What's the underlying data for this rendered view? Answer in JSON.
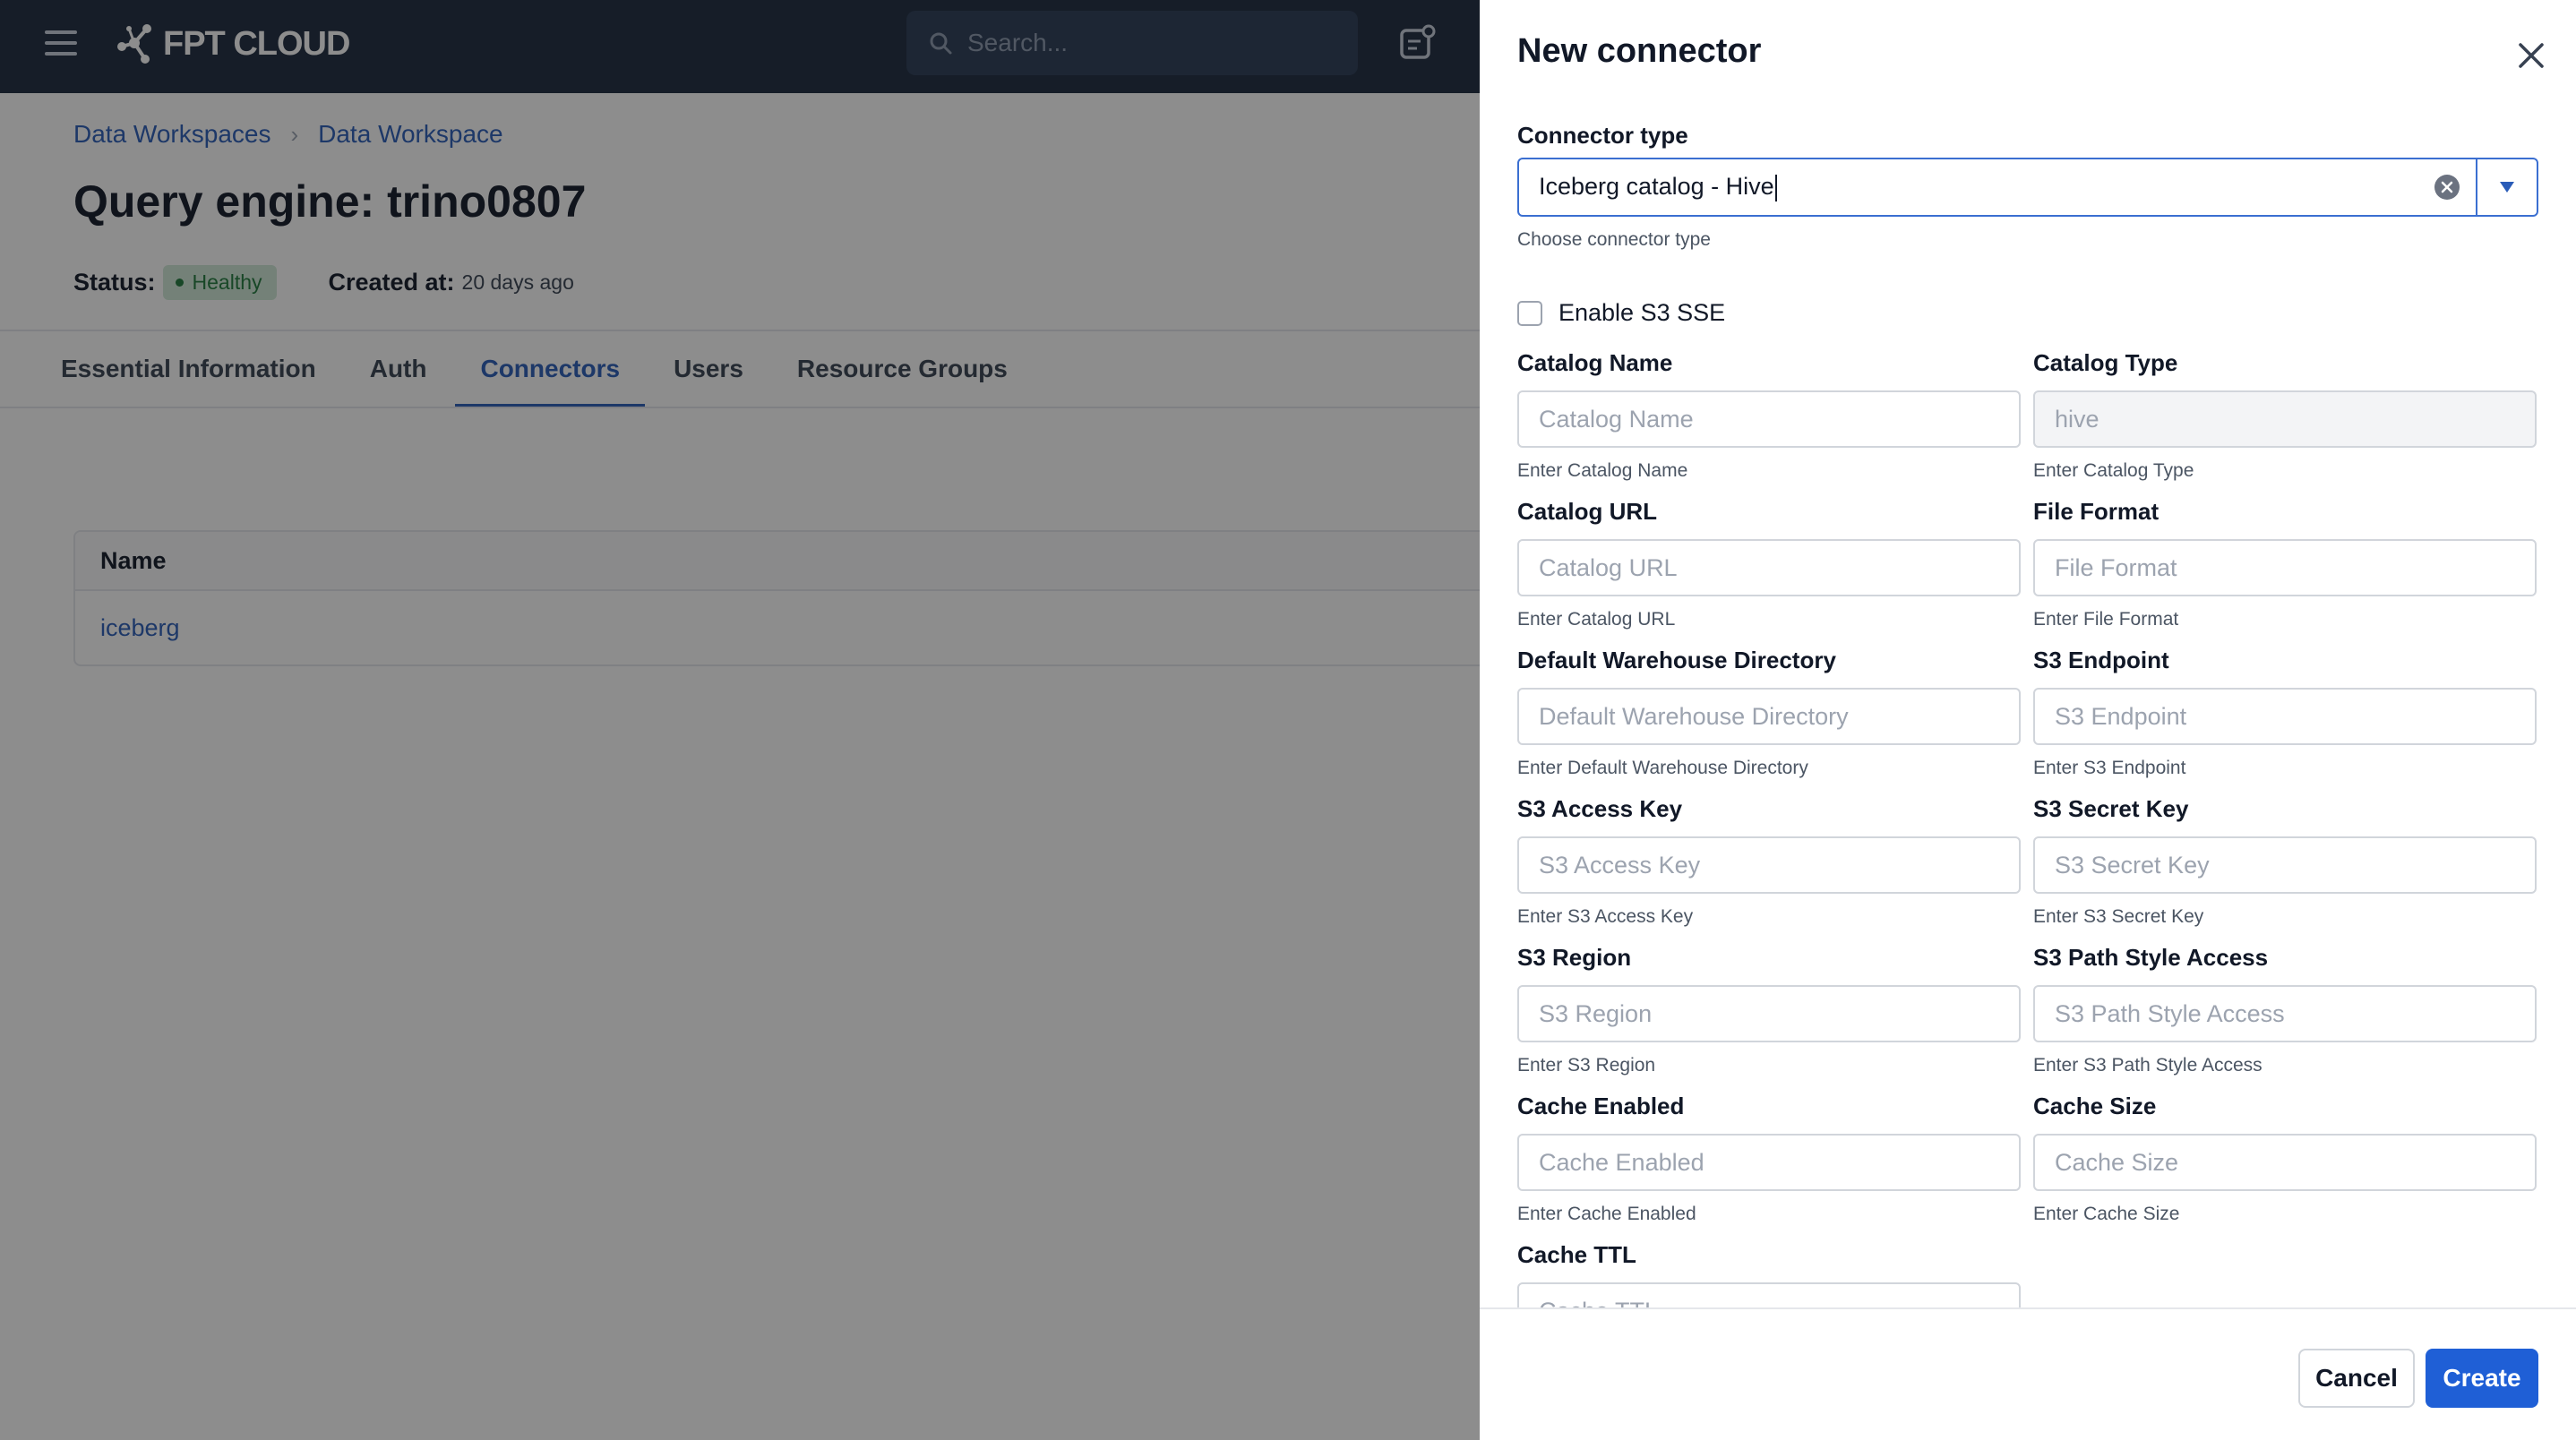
{
  "app": {
    "logo_text": "FPT CLOUD",
    "search_placeholder": "Search...",
    "breadcrumb": [
      "Data Workspaces",
      "Data Workspace"
    ],
    "title": "Query engine: trino0807",
    "status_label": "Status:",
    "status_value": "Healthy",
    "created_label": "Created at:",
    "created_value": "20 days ago",
    "tabs": [
      {
        "label": "Essential Information",
        "active": false
      },
      {
        "label": "Auth",
        "active": false
      },
      {
        "label": "Connectors",
        "active": true
      },
      {
        "label": "Users",
        "active": false
      },
      {
        "label": "Resource Groups",
        "active": false
      }
    ],
    "table": {
      "header": "Name",
      "rows": [
        "iceberg"
      ]
    }
  },
  "drawer": {
    "title": "New connector",
    "connector_type": {
      "label": "Connector type",
      "value": "Iceberg catalog - Hive",
      "help": "Choose connector type"
    },
    "sse_label": "Enable S3 SSE",
    "fields": [
      {
        "label": "Catalog Name",
        "placeholder": "Catalog Name",
        "help": "Enter Catalog Name"
      },
      {
        "label": "Catalog Type",
        "placeholder": "hive",
        "help": "Enter Catalog Type",
        "disabled": true
      },
      {
        "label": "Catalog URL",
        "placeholder": "Catalog URL",
        "help": "Enter Catalog URL"
      },
      {
        "label": "File Format",
        "placeholder": "File Format",
        "help": "Enter File Format"
      },
      {
        "label": "Default Warehouse Directory",
        "placeholder": "Default Warehouse Directory",
        "help": "Enter Default Warehouse Directory"
      },
      {
        "label": "S3 Endpoint",
        "placeholder": "S3 Endpoint",
        "help": "Enter S3 Endpoint"
      },
      {
        "label": "S3 Access Key",
        "placeholder": "S3 Access Key",
        "help": "Enter S3 Access Key"
      },
      {
        "label": "S3 Secret Key",
        "placeholder": "S3 Secret Key",
        "help": "Enter S3 Secret Key"
      },
      {
        "label": "S3 Region",
        "placeholder": "S3 Region",
        "help": "Enter S3 Region"
      },
      {
        "label": "S3 Path Style Access",
        "placeholder": "S3 Path Style Access",
        "help": "Enter S3 Path Style Access"
      },
      {
        "label": "Cache Enabled",
        "placeholder": "Cache Enabled",
        "help": "Enter Cache Enabled"
      },
      {
        "label": "Cache Size",
        "placeholder": "Cache Size",
        "help": "Enter Cache Size"
      },
      {
        "label": "Cache TTL",
        "placeholder": "Cache TTL",
        "help": ""
      }
    ],
    "cancel_label": "Cancel",
    "create_label": "Create"
  },
  "colors": {
    "topbar": "#1c2a3f",
    "accent": "#2a5cb8",
    "primary_button": "#1f5fd6",
    "status_bg": "#cfe9d6"
  }
}
